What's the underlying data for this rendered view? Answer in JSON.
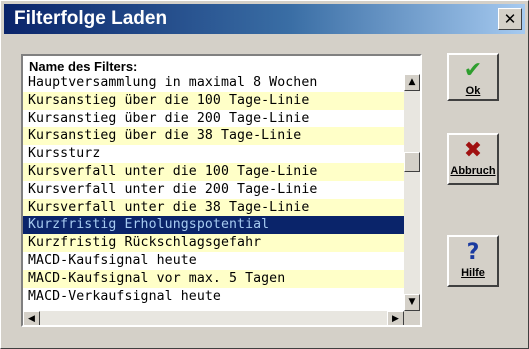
{
  "window": {
    "title": "Filterfolge Laden",
    "close_label": "✕"
  },
  "list": {
    "header": "Name des Filters:",
    "items": [
      "Hauptversammlung in maximal 8 Wochen",
      "Kursanstieg über die 100 Tage-Linie",
      "Kursanstieg über die 200 Tage-Linie",
      "Kursanstieg über die 38 Tage-Linie",
      "Kurssturz",
      "Kursverfall unter die 100 Tage-Linie",
      "Kursverfall unter die 200 Tage-Linie",
      "Kursverfall unter die 38 Tage-Linie",
      "Kurzfristig Erholungspotential",
      "Kurzfristig Rückschlagsgefahr",
      "MACD-Kaufsignal heute",
      "MACD-Kaufsignal vor max. 5 Tagen",
      "MACD-Verkaufsignal heute"
    ],
    "selected_index": 8
  },
  "buttons": {
    "ok": {
      "label": "Ok",
      "icon": "check-icon",
      "color": "#2e9e2e"
    },
    "cancel": {
      "label": "Abbruch",
      "icon": "x-icon",
      "color": "#a01010"
    },
    "help": {
      "label": "Hilfe",
      "icon": "question-icon",
      "color": "#1a3aa0"
    }
  },
  "scrollbar": {
    "up": "▲",
    "down": "▼",
    "left": "◀",
    "right": "▶"
  }
}
